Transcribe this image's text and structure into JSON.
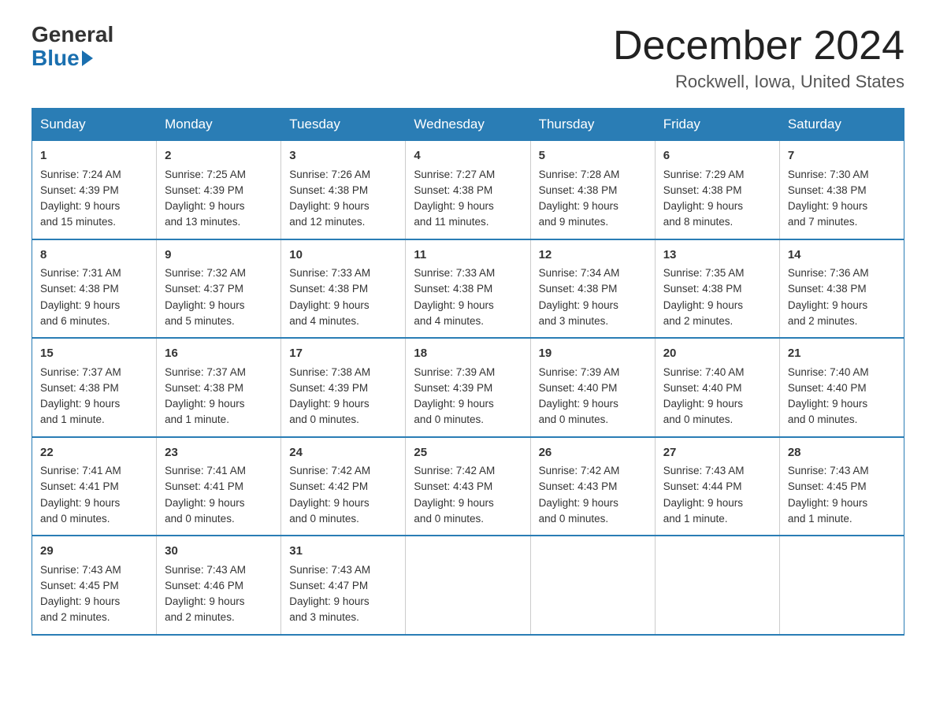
{
  "logo": {
    "general": "General",
    "blue": "Blue"
  },
  "title": "December 2024",
  "location": "Rockwell, Iowa, United States",
  "days_of_week": [
    "Sunday",
    "Monday",
    "Tuesday",
    "Wednesday",
    "Thursday",
    "Friday",
    "Saturday"
  ],
  "weeks": [
    [
      {
        "day": "1",
        "sunrise": "7:24 AM",
        "sunset": "4:39 PM",
        "daylight": "9 hours and 15 minutes."
      },
      {
        "day": "2",
        "sunrise": "7:25 AM",
        "sunset": "4:39 PM",
        "daylight": "9 hours and 13 minutes."
      },
      {
        "day": "3",
        "sunrise": "7:26 AM",
        "sunset": "4:38 PM",
        "daylight": "9 hours and 12 minutes."
      },
      {
        "day": "4",
        "sunrise": "7:27 AM",
        "sunset": "4:38 PM",
        "daylight": "9 hours and 11 minutes."
      },
      {
        "day": "5",
        "sunrise": "7:28 AM",
        "sunset": "4:38 PM",
        "daylight": "9 hours and 9 minutes."
      },
      {
        "day": "6",
        "sunrise": "7:29 AM",
        "sunset": "4:38 PM",
        "daylight": "9 hours and 8 minutes."
      },
      {
        "day": "7",
        "sunrise": "7:30 AM",
        "sunset": "4:38 PM",
        "daylight": "9 hours and 7 minutes."
      }
    ],
    [
      {
        "day": "8",
        "sunrise": "7:31 AM",
        "sunset": "4:38 PM",
        "daylight": "9 hours and 6 minutes."
      },
      {
        "day": "9",
        "sunrise": "7:32 AM",
        "sunset": "4:37 PM",
        "daylight": "9 hours and 5 minutes."
      },
      {
        "day": "10",
        "sunrise": "7:33 AM",
        "sunset": "4:38 PM",
        "daylight": "9 hours and 4 minutes."
      },
      {
        "day": "11",
        "sunrise": "7:33 AM",
        "sunset": "4:38 PM",
        "daylight": "9 hours and 4 minutes."
      },
      {
        "day": "12",
        "sunrise": "7:34 AM",
        "sunset": "4:38 PM",
        "daylight": "9 hours and 3 minutes."
      },
      {
        "day": "13",
        "sunrise": "7:35 AM",
        "sunset": "4:38 PM",
        "daylight": "9 hours and 2 minutes."
      },
      {
        "day": "14",
        "sunrise": "7:36 AM",
        "sunset": "4:38 PM",
        "daylight": "9 hours and 2 minutes."
      }
    ],
    [
      {
        "day": "15",
        "sunrise": "7:37 AM",
        "sunset": "4:38 PM",
        "daylight": "9 hours and 1 minute."
      },
      {
        "day": "16",
        "sunrise": "7:37 AM",
        "sunset": "4:38 PM",
        "daylight": "9 hours and 1 minute."
      },
      {
        "day": "17",
        "sunrise": "7:38 AM",
        "sunset": "4:39 PM",
        "daylight": "9 hours and 0 minutes."
      },
      {
        "day": "18",
        "sunrise": "7:39 AM",
        "sunset": "4:39 PM",
        "daylight": "9 hours and 0 minutes."
      },
      {
        "day": "19",
        "sunrise": "7:39 AM",
        "sunset": "4:40 PM",
        "daylight": "9 hours and 0 minutes."
      },
      {
        "day": "20",
        "sunrise": "7:40 AM",
        "sunset": "4:40 PM",
        "daylight": "9 hours and 0 minutes."
      },
      {
        "day": "21",
        "sunrise": "7:40 AM",
        "sunset": "4:40 PM",
        "daylight": "9 hours and 0 minutes."
      }
    ],
    [
      {
        "day": "22",
        "sunrise": "7:41 AM",
        "sunset": "4:41 PM",
        "daylight": "9 hours and 0 minutes."
      },
      {
        "day": "23",
        "sunrise": "7:41 AM",
        "sunset": "4:41 PM",
        "daylight": "9 hours and 0 minutes."
      },
      {
        "day": "24",
        "sunrise": "7:42 AM",
        "sunset": "4:42 PM",
        "daylight": "9 hours and 0 minutes."
      },
      {
        "day": "25",
        "sunrise": "7:42 AM",
        "sunset": "4:43 PM",
        "daylight": "9 hours and 0 minutes."
      },
      {
        "day": "26",
        "sunrise": "7:42 AM",
        "sunset": "4:43 PM",
        "daylight": "9 hours and 0 minutes."
      },
      {
        "day": "27",
        "sunrise": "7:43 AM",
        "sunset": "4:44 PM",
        "daylight": "9 hours and 1 minute."
      },
      {
        "day": "28",
        "sunrise": "7:43 AM",
        "sunset": "4:45 PM",
        "daylight": "9 hours and 1 minute."
      }
    ],
    [
      {
        "day": "29",
        "sunrise": "7:43 AM",
        "sunset": "4:45 PM",
        "daylight": "9 hours and 2 minutes."
      },
      {
        "day": "30",
        "sunrise": "7:43 AM",
        "sunset": "4:46 PM",
        "daylight": "9 hours and 2 minutes."
      },
      {
        "day": "31",
        "sunrise": "7:43 AM",
        "sunset": "4:47 PM",
        "daylight": "9 hours and 3 minutes."
      },
      null,
      null,
      null,
      null
    ]
  ],
  "labels": {
    "sunrise": "Sunrise:",
    "sunset": "Sunset:",
    "daylight": "Daylight:"
  },
  "colors": {
    "header_bg": "#2a7db5",
    "header_text": "#ffffff",
    "border": "#2a7db5"
  }
}
